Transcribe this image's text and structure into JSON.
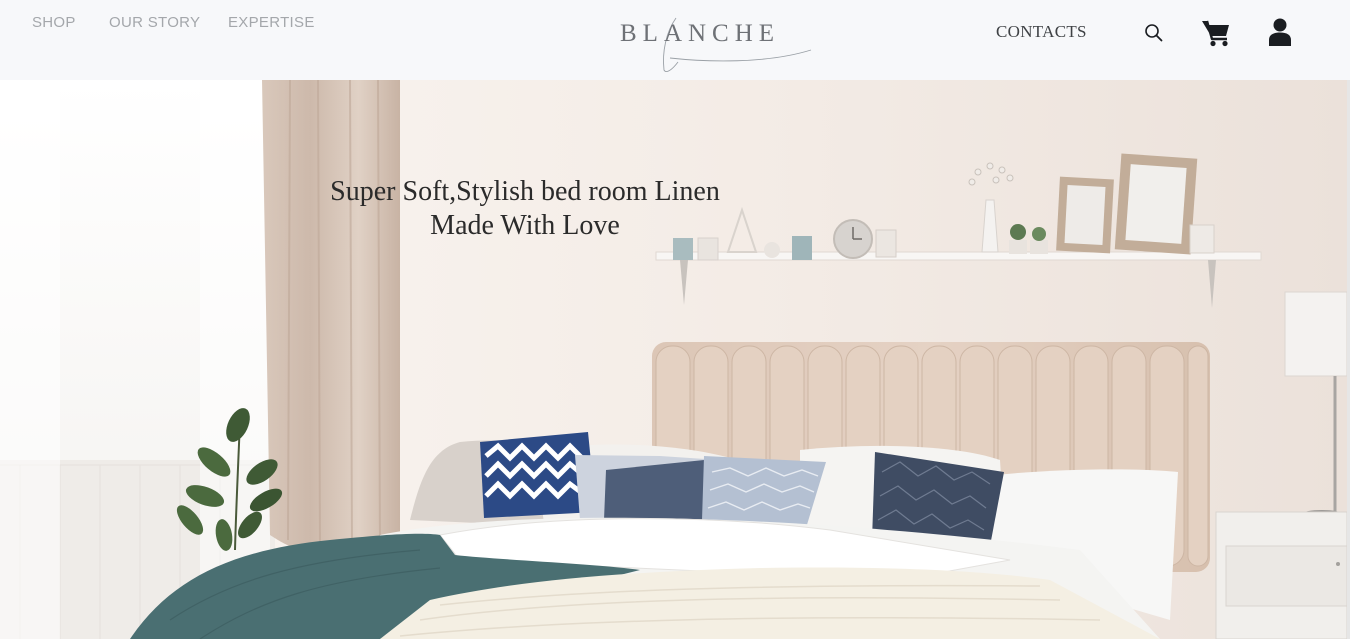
{
  "nav": {
    "left_links": [
      "SHOP",
      "OUR STORY",
      "EXPERTISE"
    ],
    "logo_text": "BLANCHE",
    "contacts_label": "CONTACTS"
  },
  "icons": {
    "search": "search-icon",
    "cart": "cart-icon",
    "account": "user-icon"
  },
  "hero": {
    "headline_line1": "Super Soft,Stylish bed room Linen",
    "headline_line2": "Made With Love"
  },
  "colors": {
    "header_bg": "#f7f8fa",
    "nav_text": "#a4a7ab",
    "contacts_text": "#3f4245",
    "icon": "#1a1d21",
    "headline": "#2b2b2b"
  }
}
